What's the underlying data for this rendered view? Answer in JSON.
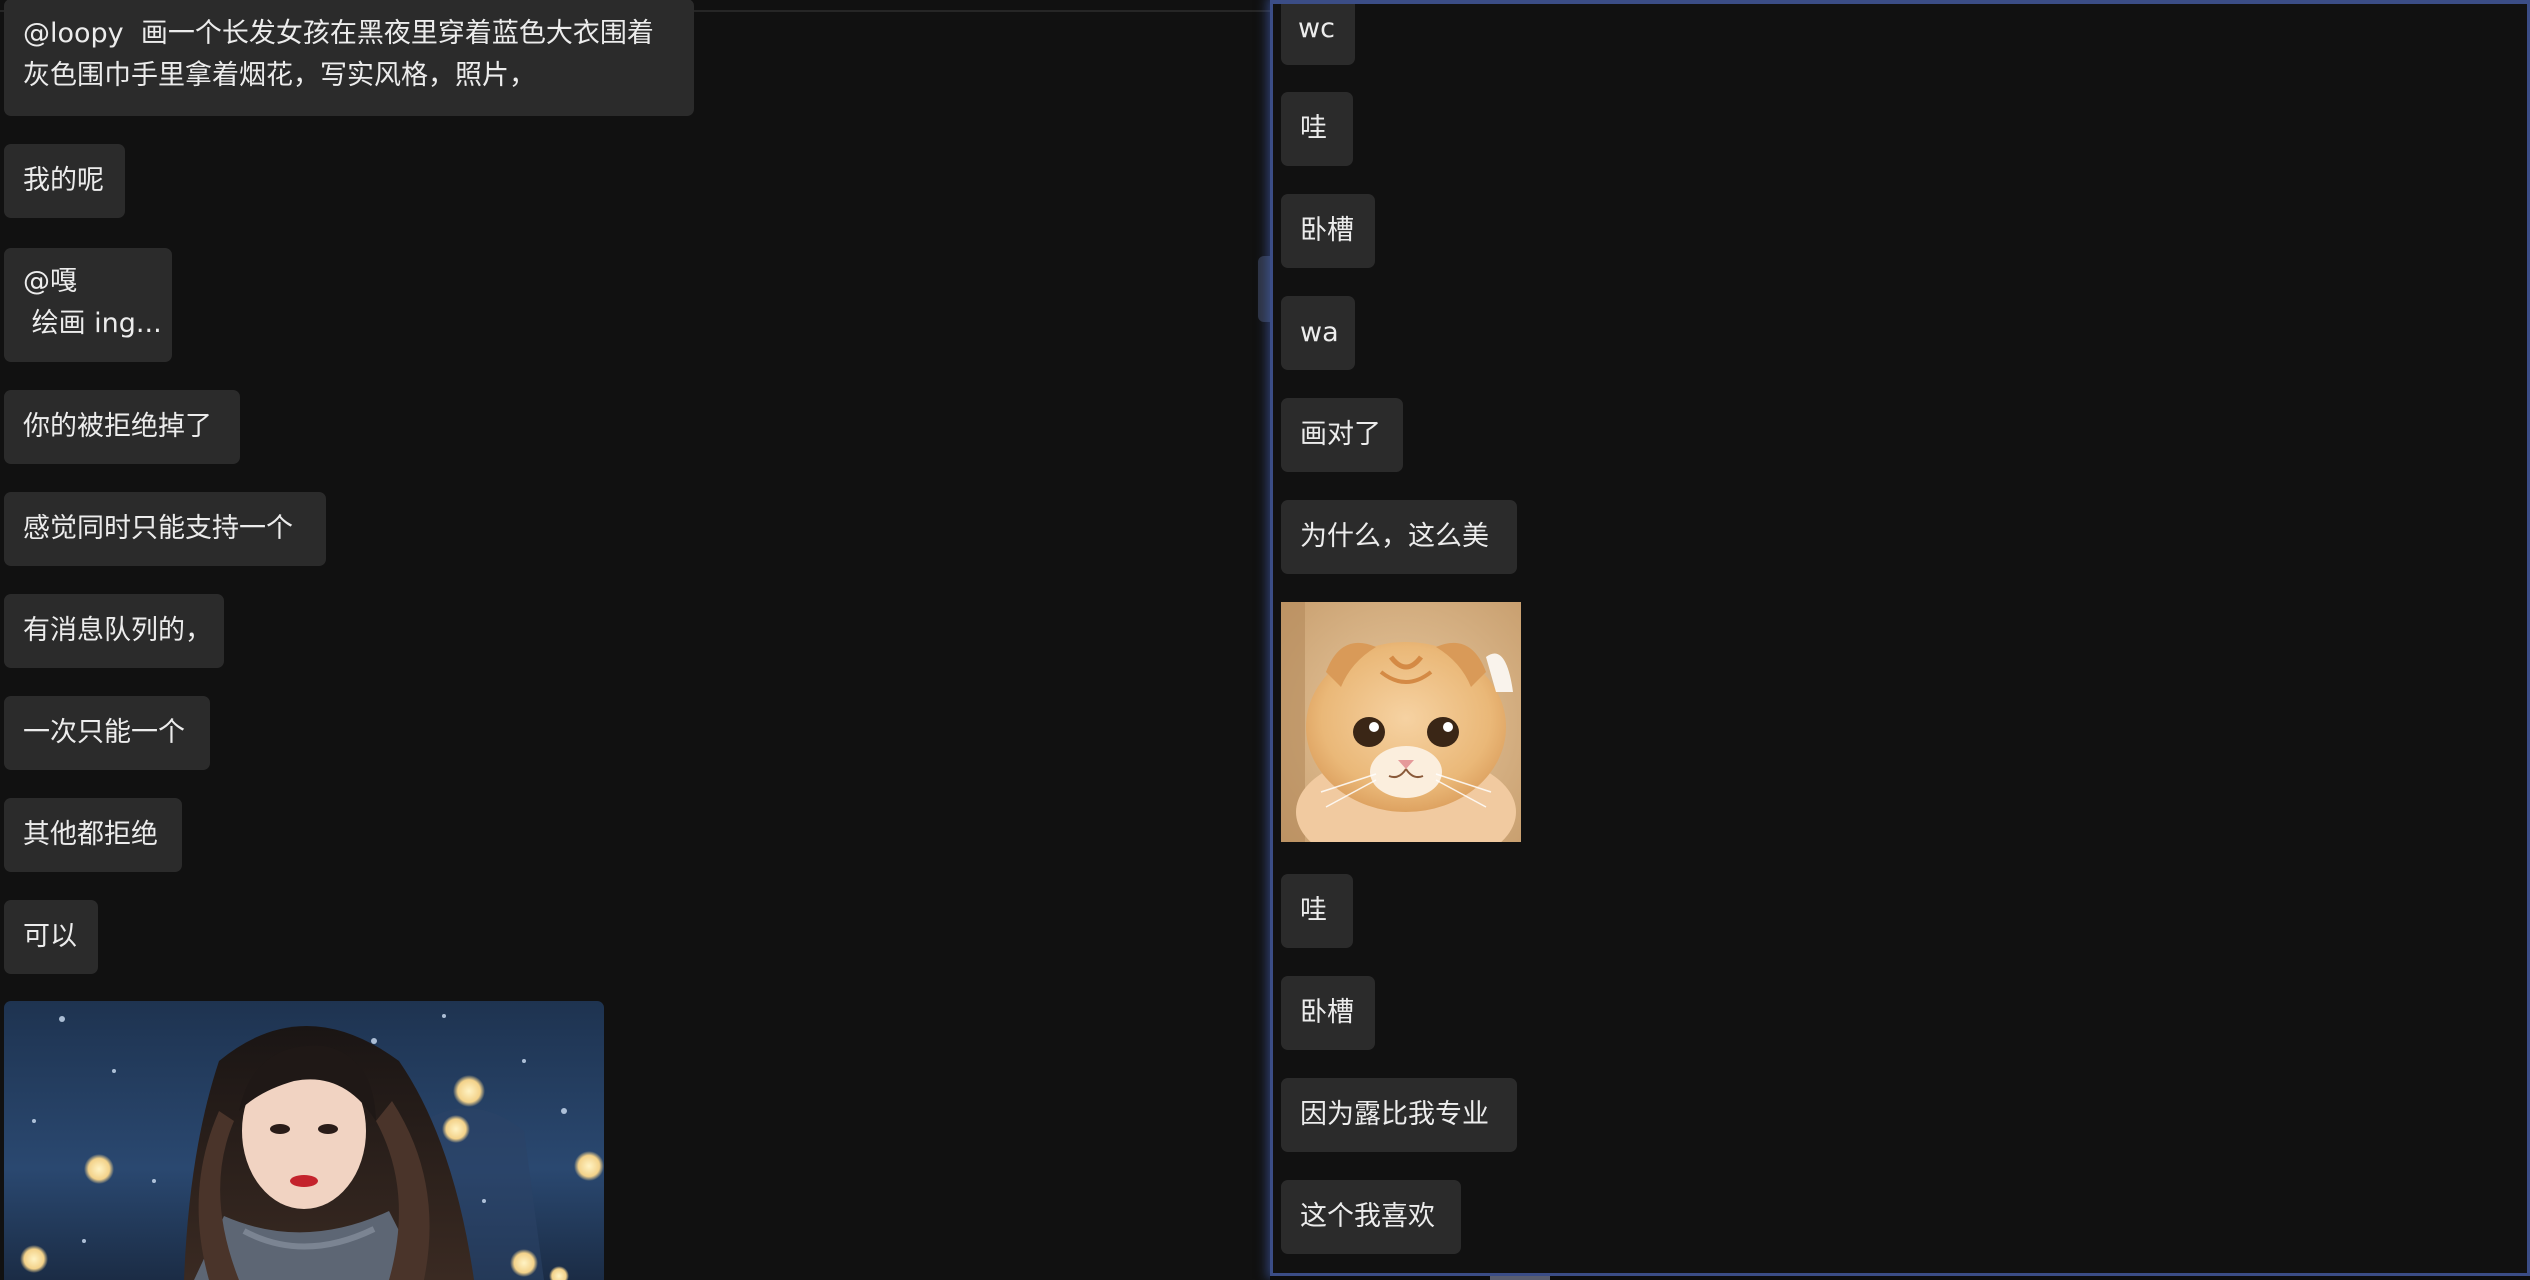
{
  "left_chat": {
    "messages": [
      {
        "text": "@loopy  画一个长发女孩在黑夜里穿着蓝色大衣围着\n灰色围巾手里拿着烟花，写实风格，照片，"
      },
      {
        "text": "我的呢"
      },
      {
        "text": "@嘎\n 绘画 ing..."
      },
      {
        "text": "你的被拒绝掉了"
      },
      {
        "text": "感觉同时只能支持一个"
      },
      {
        "text": "有消息队列的，"
      },
      {
        "text": "一次只能一个"
      },
      {
        "text": "其他都拒绝"
      },
      {
        "text": "可以"
      }
    ]
  },
  "right_chat": {
    "messages_top": [
      {
        "text": "wc"
      },
      {
        "text": "哇"
      },
      {
        "text": "卧槽"
      },
      {
        "text": "wa"
      },
      {
        "text": "画对了"
      },
      {
        "text": "为什么，这么美"
      }
    ],
    "messages_bottom": [
      {
        "text": "哇"
      },
      {
        "text": "卧槽"
      },
      {
        "text": "因为露比我专业"
      },
      {
        "text": "这个我喜欢"
      }
    ]
  },
  "colors": {
    "background": "#111111",
    "bubble": "#2b2b2b",
    "text": "#ececec",
    "focus_border": "#3b4d86"
  }
}
